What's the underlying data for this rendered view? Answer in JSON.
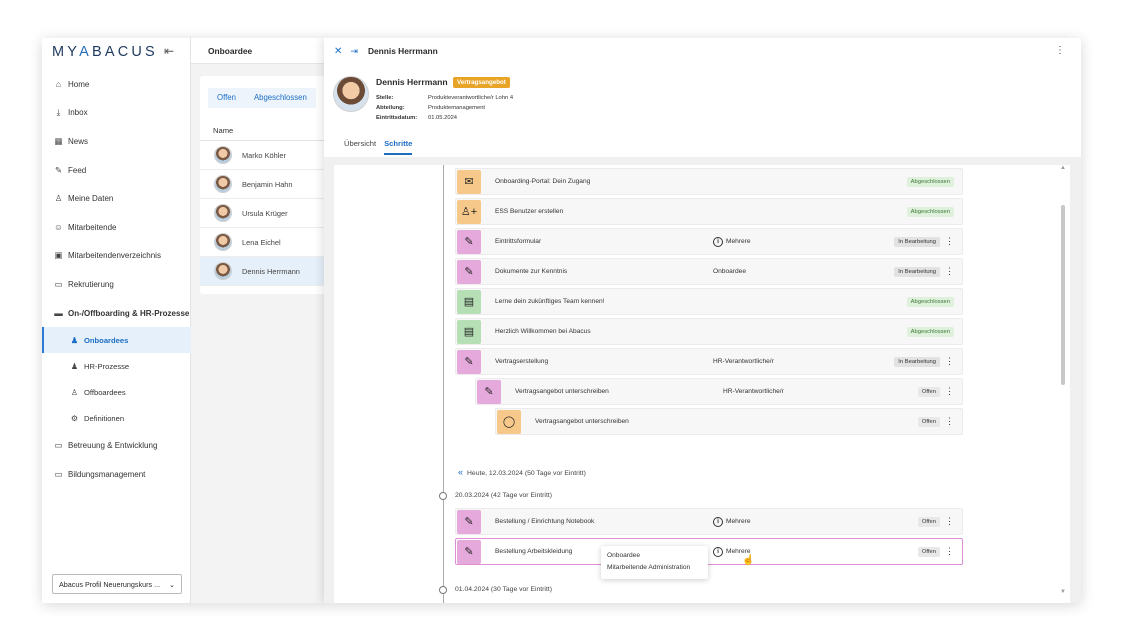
{
  "brand": {
    "logo_a": "MY",
    "logo_y": "A",
    "logo_b": "BACUS"
  },
  "sidebar": {
    "items": [
      {
        "icon": "⌂",
        "label": "Home"
      },
      {
        "icon": "⤓",
        "label": "Inbox"
      },
      {
        "icon": "▦",
        "label": "News"
      },
      {
        "icon": "✎",
        "label": "Feed"
      },
      {
        "icon": "♙",
        "label": "Meine Daten"
      },
      {
        "icon": "☺",
        "label": "Mitarbeitende"
      },
      {
        "icon": "▣",
        "label": "Mitarbeitendenverzeichnis"
      },
      {
        "icon": "▭",
        "label": "Rekrutierung"
      },
      {
        "icon": "▬",
        "label": "On-/Offboarding & HR-Prozesse"
      }
    ],
    "subitems": [
      {
        "icon": "♟",
        "label": "Onboardees"
      },
      {
        "icon": "♟",
        "label": "HR-Prozesse"
      },
      {
        "icon": "♙",
        "label": "Offboardees"
      },
      {
        "icon": "⚙",
        "label": "Definitionen"
      }
    ],
    "items2": [
      {
        "icon": "▭",
        "label": "Betreuung & Entwicklung"
      },
      {
        "icon": "▭",
        "label": "Bildungsmanagement"
      }
    ],
    "profile_select": "Abacus Profil Neuerungskurs ..."
  },
  "list": {
    "title": "Onboardee",
    "tabs": [
      "Offen",
      "Abgeschlossen"
    ],
    "column": "Name",
    "rows": [
      "Marko Köhler",
      "Benjamin Hahn",
      "Ursula Krüger",
      "Lena Eichel",
      "Dennis Herrmann"
    ]
  },
  "detail": {
    "header_title": "Dennis Herrmann",
    "name": "Dennis Herrmann",
    "badge": "Vertragsangebot",
    "fields": [
      {
        "k": "Stelle:",
        "v": "Produkteverantwortliche/r Lohn 4"
      },
      {
        "k": "Abteilung:",
        "v": "Produktemanagement"
      },
      {
        "k": "Eintrittsdatum:",
        "v": "01.05.2024"
      }
    ],
    "tabs": [
      "Übersicht",
      "Schritte"
    ],
    "steps": [
      {
        "icon": "✉",
        "title": "Onboarding-Portal: Dein Zugang",
        "who": "",
        "status": "Abgeschlossen"
      },
      {
        "icon": "♙+",
        "title": "ESS Benutzer erstellen",
        "who": "",
        "status": "Abgeschlossen"
      },
      {
        "icon": "✎",
        "title": "Eintrittsformular",
        "who": "Mehrere",
        "status": "In Bearbeitung"
      },
      {
        "icon": "✎",
        "title": "Dokumente zur Kenntnis",
        "who": "Onboardee",
        "status": "In Bearbeitung"
      },
      {
        "icon": "▤",
        "title": "Lerne dein zukünftiges Team kennen!",
        "who": "",
        "status": "Abgeschlossen"
      },
      {
        "icon": "▤",
        "title": "Herzlich Willkommen bei Abacus",
        "who": "",
        "status": "Abgeschlossen"
      },
      {
        "icon": "✎",
        "title": "Vertragserstellung",
        "who": "HR-Verantwortliche/r",
        "status": "In Bearbeitung"
      },
      {
        "icon": "✎",
        "title": "Vertragsangebot unterschreiben",
        "who": "HR-Verantwortliche/r",
        "status": "Offen"
      },
      {
        "icon": "◯",
        "title": "Vertragsangebot unterschreiben",
        "who": "",
        "status": "Offen"
      }
    ],
    "today": "Heute, 12.03.2024 (50 Tage vor Eintritt)",
    "date1": "20.03.2024 (42 Tage vor Eintritt)",
    "steps2": [
      {
        "icon": "✎",
        "title": "Bestellung / Einrichtung Notebook",
        "who": "Mehrere",
        "status": "Offen"
      },
      {
        "icon": "✎",
        "title": "Bestellung Arbeitskleidung",
        "who": "Mehrere",
        "status": "Offen"
      }
    ],
    "date2": "01.04.2024 (30 Tage vor Eintritt)",
    "tooltip": [
      "Onboardee",
      "Mitarbeitende Administration"
    ]
  },
  "colors": {
    "accent": "#1c6ec4",
    "badge": "#e8a426",
    "done": "#3b7a34"
  }
}
